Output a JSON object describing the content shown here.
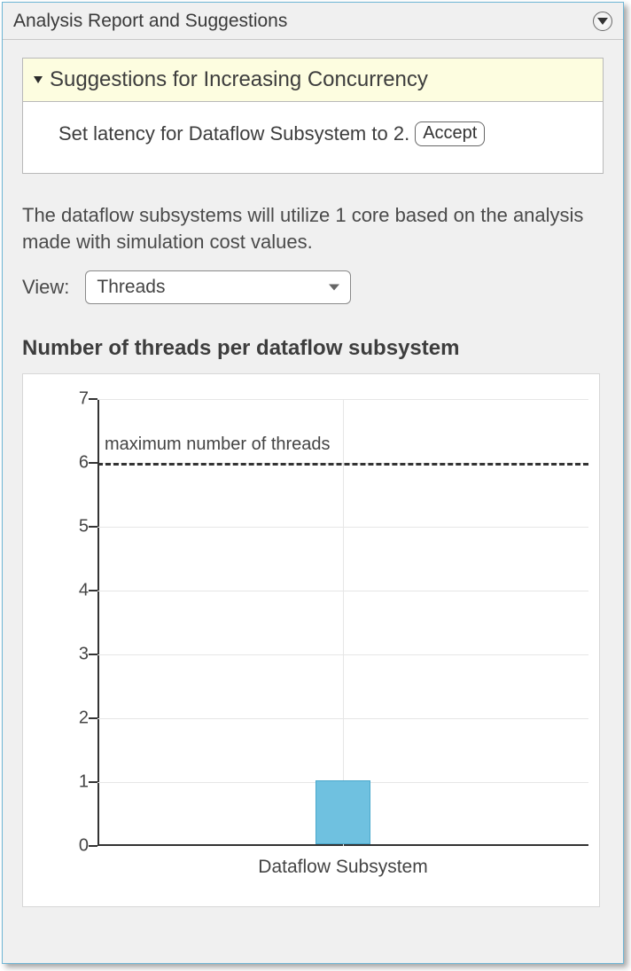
{
  "header": {
    "title": "Analysis Report and Suggestions"
  },
  "suggestions": {
    "section_title": "Suggestions for Increasing Concurrency",
    "item_text": "Set latency for Dataflow Subsystem to 2.",
    "accept_label": "Accept"
  },
  "description": "The dataflow subsystems will utilize 1 core based on the analysis made with simulation cost values.",
  "view": {
    "label": "View:",
    "selected": "Threads"
  },
  "chart_title": "Number of threads per dataflow subsystem",
  "chart_data": {
    "type": "bar",
    "categories": [
      "Dataflow Subsystem"
    ],
    "values": [
      1
    ],
    "y_ticks": [
      0,
      1,
      2,
      3,
      4,
      5,
      6,
      7
    ],
    "ylim": [
      0,
      7
    ],
    "reference_line": {
      "value": 6,
      "label": "maximum number of threads"
    },
    "title": "Number of threads per dataflow subsystem",
    "xlabel": "",
    "ylabel": ""
  },
  "colors": {
    "panel_border": "#6fb6d6",
    "bar_fill": "#6fc1e0",
    "suggestion_header_bg": "#fdfde0"
  }
}
